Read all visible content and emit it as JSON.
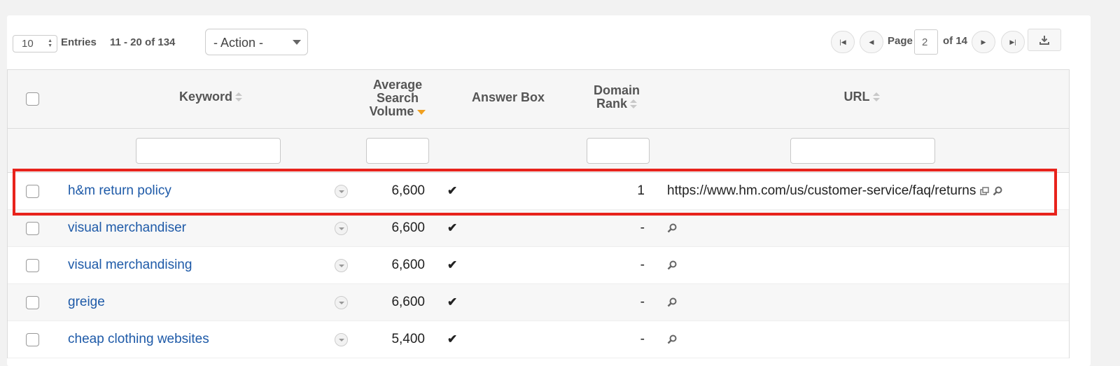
{
  "toolbar": {
    "entries_value": "10",
    "entries_label": "Entries",
    "range_text": "11 - 20 of 134",
    "action_value": "- Action -",
    "page_label": "Page",
    "page_value": "2",
    "page_total": "of 14"
  },
  "table": {
    "headers": {
      "keyword": "Keyword",
      "avg_line1": "Average",
      "avg_line2": "Search",
      "avg_line3": "Volume",
      "answer_box": "Answer Box",
      "rank_line1": "Domain",
      "rank_line2": "Rank",
      "url": "URL"
    },
    "rows": [
      {
        "keyword": "h&m return policy",
        "volume": "6,600",
        "answer_box": "✔",
        "rank": "1",
        "url": "https://www.hm.com/us/customer-service/faq/returns"
      },
      {
        "keyword": "visual merchandiser",
        "volume": "6,600",
        "answer_box": "✔",
        "rank": "-",
        "url": ""
      },
      {
        "keyword": "visual merchandising",
        "volume": "6,600",
        "answer_box": "✔",
        "rank": "-",
        "url": ""
      },
      {
        "keyword": "greige",
        "volume": "6,600",
        "answer_box": "✔",
        "rank": "-",
        "url": ""
      },
      {
        "keyword": "cheap clothing websites",
        "volume": "5,400",
        "answer_box": "✔",
        "rank": "-",
        "url": ""
      }
    ]
  },
  "colors": {
    "link": "#1e5aa8",
    "highlight": "#e8231c",
    "sort_active": "#f0a020"
  }
}
